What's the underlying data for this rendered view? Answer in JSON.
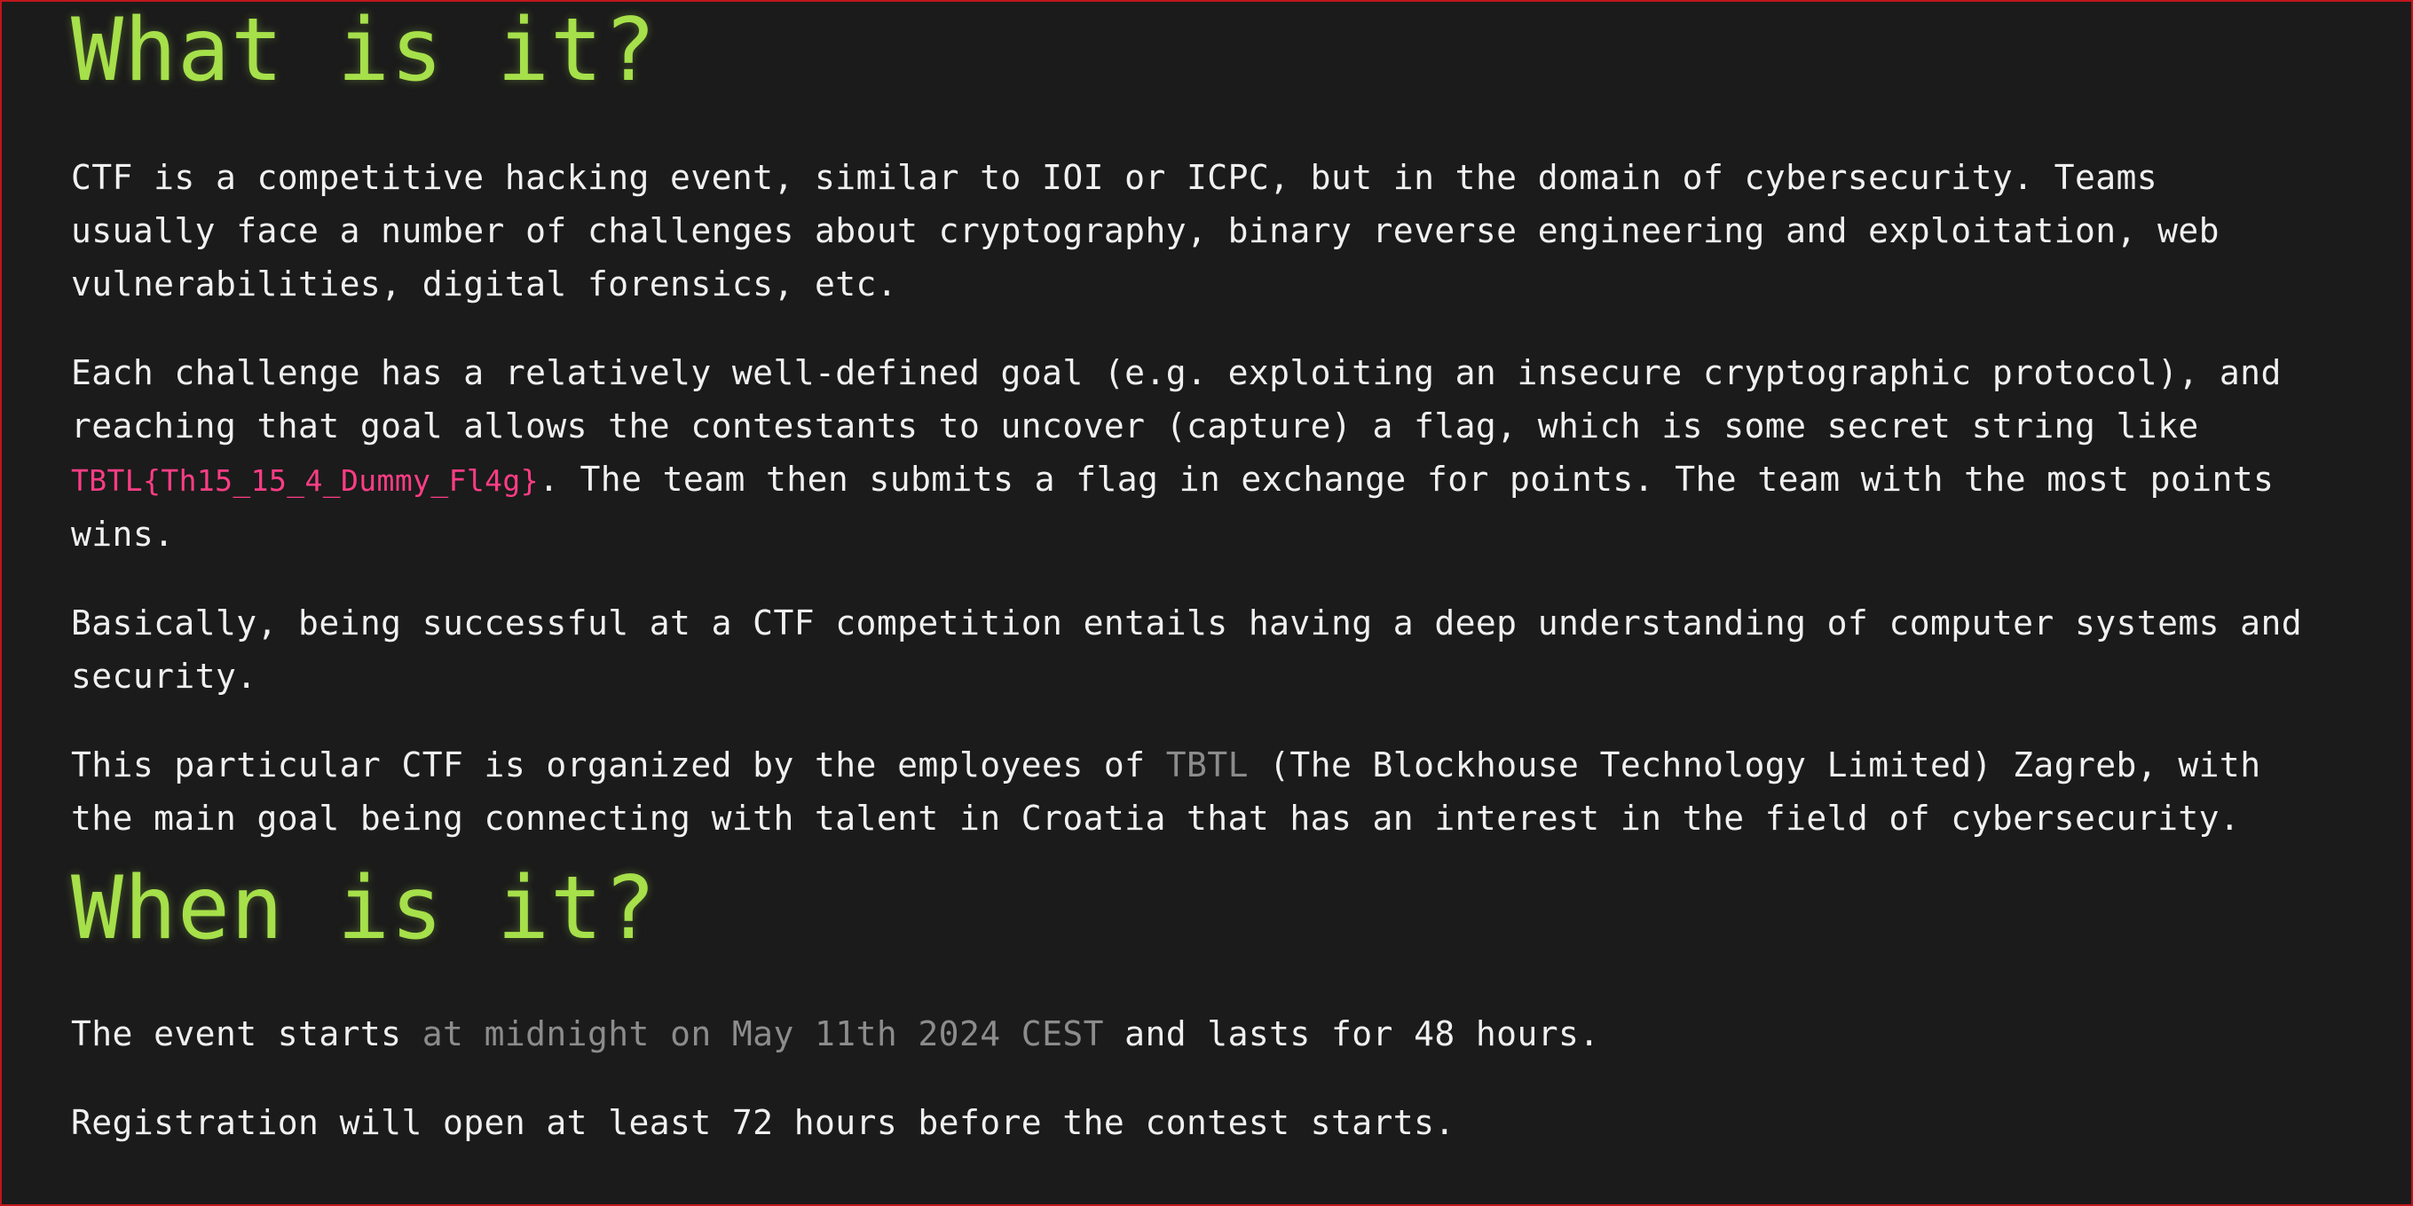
{
  "what": {
    "heading": "What is it?",
    "p1": [
      "CTF is a competitive hacking event, similar to IOI or ICPC, but in the domain of cybersecurity. Teams",
      "usually face a number of challenges about cryptography, binary reverse engineering and exploitation, web",
      "vulnerabilities, digital forensics, etc."
    ],
    "p2": {
      "line1": "Each challenge has a relatively well-defined goal (e.g. exploiting an insecure cryptographic protocol), and",
      "line2": "reaching that goal allows the contestants to uncover (capture) a flag, which is some secret string like",
      "flag": "TBTL{Th15_15_4_Dummy_Fl4g}",
      "line3_rest": ". The team then submits a flag in exchange for points. The team with the most points",
      "line4": "wins."
    },
    "p3": [
      "Basically, being successful at a CTF competition entails having a deep understanding of computer systems and",
      "security."
    ],
    "p4": {
      "line1_pre": "This particular CTF is organized by the employees of ",
      "org": "TBTL",
      "line1_post": " (The Blockhouse Technology Limited) Zagreb, with",
      "line2": "the main goal being connecting with talent in Croatia that has an interest in the field of cybersecurity."
    }
  },
  "when": {
    "heading": "When is it?",
    "p1": {
      "pre": "The event starts ",
      "time": "at midnight on May 11th 2024 CEST",
      "post": " and lasts for 48 hours."
    },
    "p2": "Registration will open at least 72 hours before the contest starts."
  },
  "colors": {
    "background": "#1b1b1b",
    "heading": "#a6e04a",
    "text": "#f0f0f0",
    "flag": "#ff3d85",
    "muted": "#8c8c8c",
    "frame": "#c0151c"
  }
}
